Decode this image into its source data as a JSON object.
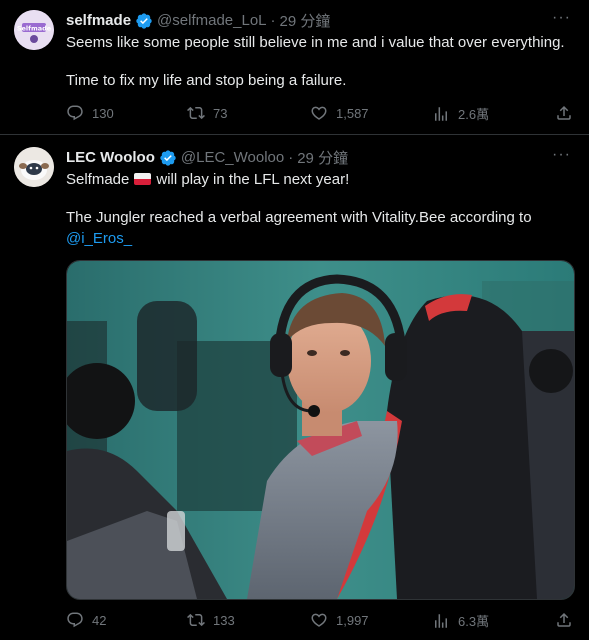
{
  "tweets": [
    {
      "author_name": "selfmade",
      "author_handle": "@selfmade_LoL",
      "separator": "·",
      "time": "29 分鐘",
      "more": "···",
      "avatar_text": "Selfmade",
      "lines": [
        "Seems like some people still believe in me and i value that over everything.",
        "Time to fix my life and stop being a failure."
      ],
      "stats": {
        "replies": "130",
        "retweets": "73",
        "likes": "1,587",
        "views": "2.6萬"
      }
    },
    {
      "author_name": "LEC Wooloo",
      "author_handle": "@LEC_Wooloo",
      "separator": "·",
      "time": "29 分鐘",
      "more": "···",
      "line1_before_flag": "Selfmade",
      "line1_after_flag": "will play in the LFL next year!",
      "line2": "The Jungler reached a verbal agreement with Vitality.Bee according to",
      "mention": "@i_Eros_",
      "stats": {
        "replies": "42",
        "retweets": "133",
        "likes": "1,997",
        "views": "6.3萬"
      }
    }
  ],
  "colors": {
    "background": "#000000",
    "text": "#e7e9ea",
    "muted": "#71767b",
    "link": "#1d9bf0",
    "verified": "#1d9bf0",
    "divider": "#2f3336"
  },
  "icons": [
    "reply-icon",
    "retweet-icon",
    "like-icon",
    "views-icon",
    "share-icon",
    "verified-badge-icon",
    "more-icon",
    "poland-flag-icon"
  ]
}
